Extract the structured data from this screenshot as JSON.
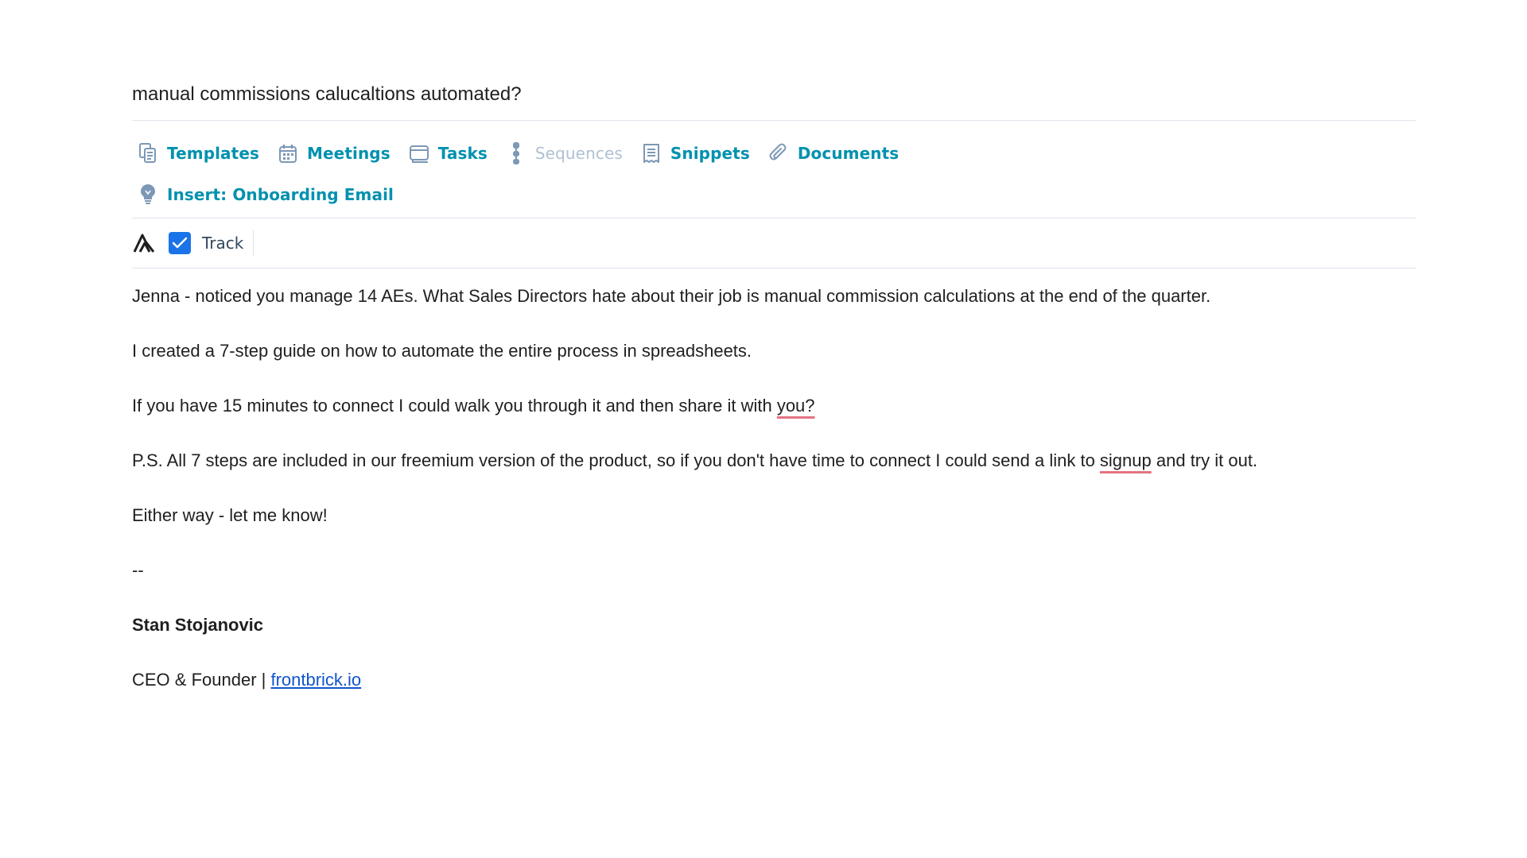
{
  "subject": "manual commissions calucaltions automated?",
  "tools": [
    {
      "label": "Templates",
      "icon": "templates-icon",
      "enabled": true
    },
    {
      "label": "Meetings",
      "icon": "calendar-icon",
      "enabled": true
    },
    {
      "label": "Tasks",
      "icon": "tasks-icon",
      "enabled": true
    },
    {
      "label": "Sequences",
      "icon": "sequences-icon",
      "enabled": false
    },
    {
      "label": "Snippets",
      "icon": "snippets-icon",
      "enabled": true
    },
    {
      "label": "Documents",
      "icon": "paperclip-icon",
      "enabled": true
    }
  ],
  "insert": {
    "label": "Insert: Onboarding Email",
    "icon": "lightbulb-icon"
  },
  "track": {
    "label": "Track",
    "checked": true
  },
  "body": {
    "p1": "Jenna - noticed you manage 14 AEs. What Sales Directors hate about their job is manual commission calculations at the end of the quarter.",
    "p2": "I created a 7-step guide on how to automate the entire process in spreadsheets.",
    "p3_before": "If you have 15 minutes to connect I could walk you through it and then share it with ",
    "p3_flagged": "you?",
    "p4_before": "P.S. All 7 steps are included in our freemium version of the product, so if you don't have time to connect I could send a link to ",
    "p4_flagged": "signup",
    "p4_after": " and try it out.",
    "p5": "Either way - let me know!"
  },
  "signature": {
    "dash": "--",
    "name": "Stan Stojanovic",
    "title": "CEO & Founder | ",
    "link": "frontbrick.io"
  },
  "colors": {
    "accent": "#0091ae",
    "disabled": "#b0c1d4",
    "checkbox": "#1a73e8",
    "spellcheck": "#e57382",
    "link": "#1155cc"
  }
}
